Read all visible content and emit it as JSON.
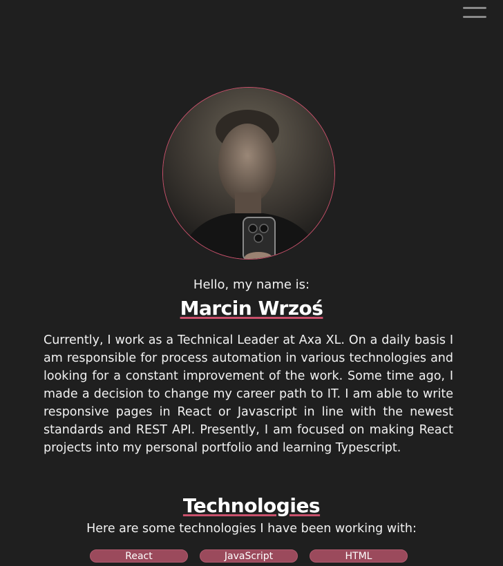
{
  "header": {
    "menu_icon": "hamburger-menu-icon"
  },
  "profile": {
    "avatar_description": "profile-photo",
    "greeting": "Hello, my name is:",
    "name": "Marcin Wrzoś",
    "bio": "Currently, I work as a Technical Leader at Axa XL. On a daily basis I am responsible for process automation in various technologies and looking for a constant improvement of the work. Some time ago, I made a decision to change my career path to IT. I am able to write responsive pages in React or Javascript in line with the newest standards and REST API. Presently, I am focused on making React projects into my personal portfolio and learning Typescript."
  },
  "technologies": {
    "title": "Technologies",
    "subtitle": "Here are some technologies I have been working with:",
    "items": [
      "React",
      "JavaScript",
      "HTML"
    ]
  },
  "colors": {
    "background": "#1f1f1f",
    "accent": "#c9506b",
    "pill": "#9b4a5c"
  }
}
